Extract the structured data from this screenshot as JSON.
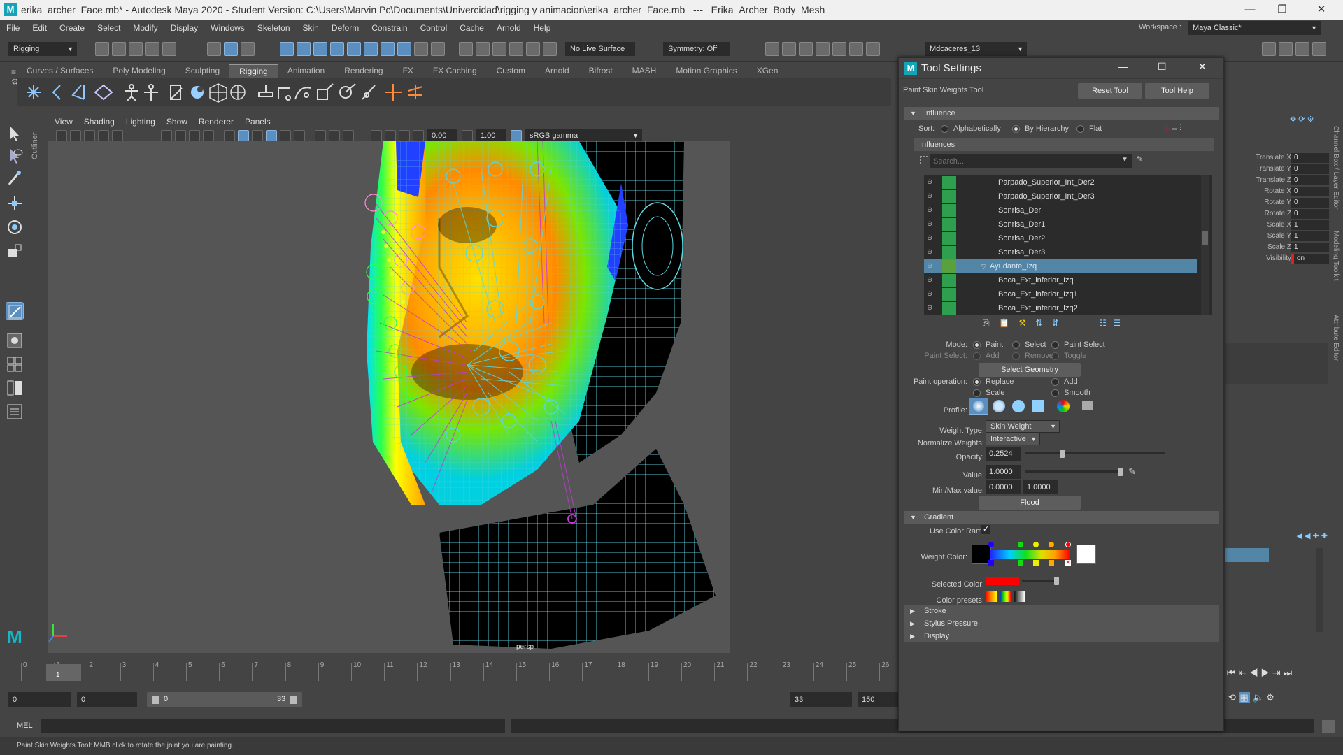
{
  "window": {
    "title": "erika_archer_Face.mb* - Autodesk Maya 2020 - Student Version: C:\\Users\\Marvin Pc\\Documents\\Univercidad\\rigging y animacion\\erika_archer_Face.mb   ---   Erika_Archer_Body_Mesh",
    "logo": "M",
    "minimize": "—",
    "restore": "❐",
    "close": "✕"
  },
  "menubar": {
    "items": [
      "File",
      "Edit",
      "Create",
      "Select",
      "Modify",
      "Display",
      "Windows",
      "Skeleton",
      "Skin",
      "Deform",
      "Constrain",
      "Control",
      "Cache",
      "Arnold",
      "Help"
    ],
    "workspace_label": "Workspace :",
    "workspace_value": "Maya Classic*"
  },
  "statusline": {
    "menuset": "Rigging",
    "live_surface": "No Live Surface",
    "symmetry": "Symmetry: Off",
    "user": "Mdcaceres_13"
  },
  "shelf": {
    "tabs": [
      "Curves / Surfaces",
      "Poly Modeling",
      "Sculpting",
      "Rigging",
      "Animation",
      "Rendering",
      "FX",
      "FX Caching",
      "Custom",
      "Arnold",
      "Bifrost",
      "MASH",
      "Motion Graphics",
      "XGen"
    ],
    "active_tab": "Rigging"
  },
  "viewport": {
    "menus": [
      "View",
      "Shading",
      "Lighting",
      "Show",
      "Renderer",
      "Panels"
    ],
    "exposure": "0.00",
    "gamma": "1.00",
    "colorspace": "sRGB gamma",
    "camera_label": "persp",
    "outliner_tab": "Outliner"
  },
  "tool_settings": {
    "window_title": "Tool Settings",
    "tool_name": "Paint Skin Weights Tool",
    "reset_button": "Reset Tool",
    "help_button": "Tool Help",
    "influence": {
      "header": "Influence",
      "sort_label": "Sort:",
      "sort_options": [
        "Alphabetically",
        "By Hierarchy",
        "Flat"
      ],
      "sort_selected": "By Hierarchy",
      "influences_header": "Influences",
      "search_placeholder": "Search...",
      "items": [
        {
          "name": "Parpado_Superior_Int_Der2",
          "selected": false
        },
        {
          "name": "Parpado_Superior_Int_Der3",
          "selected": false
        },
        {
          "name": "Sonrisa_Der",
          "selected": false
        },
        {
          "name": "Sonrisa_Der1",
          "selected": false
        },
        {
          "name": "Sonrisa_Der2",
          "selected": false
        },
        {
          "name": "Sonrisa_Der3",
          "selected": false
        },
        {
          "name": "Ayudante_Izq",
          "selected": true
        },
        {
          "name": "Boca_Ext_inferior_Izq",
          "selected": false
        },
        {
          "name": "Boca_Ext_inferior_Izq1",
          "selected": false
        },
        {
          "name": "Boca_Ext_inferior_Izq2",
          "selected": false
        }
      ]
    },
    "mode": {
      "label": "Mode:",
      "options": [
        "Paint",
        "Select",
        "Paint Select"
      ],
      "selected": "Paint",
      "paint_select_label": "Paint Select:",
      "paint_select_options": [
        "Add",
        "Remove",
        "Toggle"
      ],
      "select_geometry_button": "Select Geometry"
    },
    "paint_operation": {
      "label": "Paint operation:",
      "options": [
        "Replace",
        "Add",
        "Scale",
        "Smooth"
      ],
      "selected": "Replace"
    },
    "profile_label": "Profile:",
    "weight_type": {
      "label": "Weight Type:",
      "value": "Skin Weight"
    },
    "normalize_weights": {
      "label": "Normalize Weights:",
      "value": "Interactive"
    },
    "opacity": {
      "label": "Opacity:",
      "value": "0.2524",
      "fraction": 0.2524
    },
    "value": {
      "label": "Value:",
      "value": "1.0000",
      "fraction": 1.0
    },
    "minmax": {
      "label": "Min/Max value:",
      "min": "0.0000",
      "max": "1.0000"
    },
    "flood_button": "Flood",
    "gradient": {
      "header": "Gradient",
      "use_color_ramp_label": "Use Color Ramp",
      "use_color_ramp_checked": true,
      "weight_color_label": "Weight Color:",
      "selected_color_label": "Selected Color:",
      "selected_color": "#ff0000",
      "color_presets_label": "Color presets:"
    },
    "collapsed_sections": [
      "Stroke",
      "Stylus Pressure",
      "Display"
    ]
  },
  "channel_box": {
    "rows": [
      {
        "label": "Translate X",
        "value": "0"
      },
      {
        "label": "Translate Y",
        "value": "0"
      },
      {
        "label": "Translate Z",
        "value": "0"
      },
      {
        "label": "Rotate X",
        "value": "0"
      },
      {
        "label": "Rotate Y",
        "value": "0"
      },
      {
        "label": "Rotate Z",
        "value": "0"
      },
      {
        "label": "Scale X",
        "value": "1"
      },
      {
        "label": "Scale Y",
        "value": "1"
      },
      {
        "label": "Scale Z",
        "value": "1"
      },
      {
        "label": "Visibility",
        "value": "on"
      }
    ],
    "side_tabs": [
      "Channel Box / Layer Editor",
      "Modeling Toolkit",
      "Attribute Editor"
    ]
  },
  "timeline": {
    "ticks": [
      "0",
      "1",
      "2",
      "3",
      "4",
      "5",
      "6",
      "7",
      "8",
      "9",
      "10",
      "11",
      "12",
      "13",
      "14",
      "15",
      "16",
      "17",
      "18",
      "19",
      "20",
      "21",
      "22",
      "23",
      "24",
      "25",
      "26"
    ],
    "current_frame": "1",
    "range_start": "0",
    "playback_start": "0",
    "slider_min": "0",
    "slider_max": "33",
    "playback_end": "33",
    "range_end": "150"
  },
  "command_line": {
    "mel_label": "MEL"
  },
  "help_line": "Paint Skin Weights Tool: MMB click to rotate the joint you are painting.",
  "colors": {
    "accent_blue": "#5285a6",
    "influence_green": "#2e9e4f",
    "panel_bg": "#444444",
    "field_bg": "#2b2b2b",
    "wire_cyan": "#5cd6e0",
    "joint_magenta": "#c23ad6"
  }
}
